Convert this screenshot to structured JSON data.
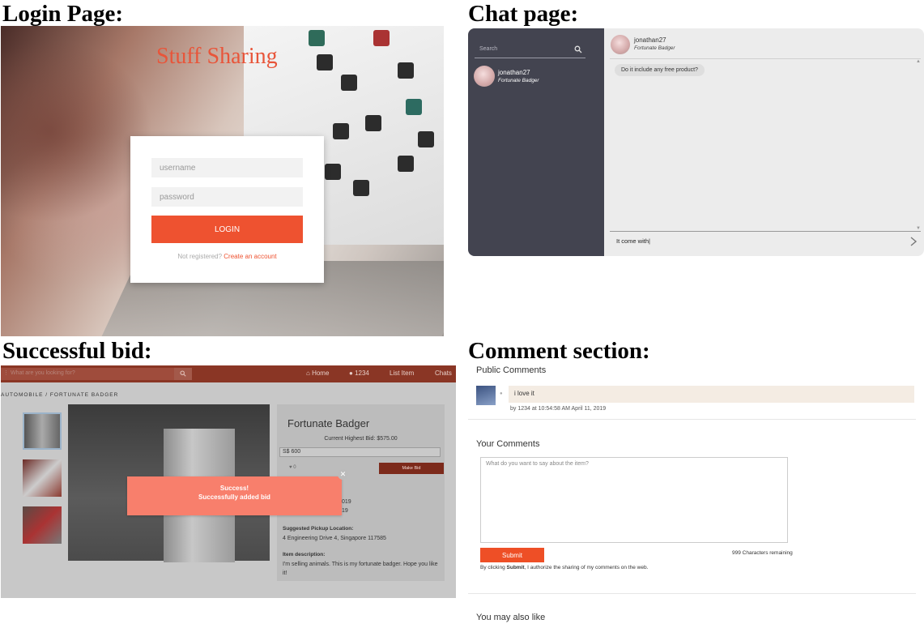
{
  "headings": {
    "login": "Login Page:",
    "chat": "Chat page:",
    "bid": "Successful bid:",
    "comments": "Comment section:"
  },
  "login": {
    "brand": "Stuff Sharing",
    "username_placeholder": "username",
    "password_placeholder": "password",
    "login_button": "LOGIN",
    "not_registered": "Not registered?",
    "create_account": "Create an account",
    "accent_color": "#ee5230"
  },
  "chat": {
    "search_placeholder": "Search",
    "contacts": [
      {
        "name": "jonathan27",
        "subtitle": "Fortunate Badger"
      }
    ],
    "header": {
      "name": "jonathan27",
      "subtitle": "Fortunate Badger"
    },
    "messages": [
      {
        "text": "Do it include any free product?"
      }
    ],
    "composer_text": "It come with"
  },
  "bid": {
    "nav": {
      "search_placeholder": "What are you looking for?",
      "home": "Home",
      "user": "1234",
      "list_item": "List Item",
      "chats": "Chats"
    },
    "breadcrumb": "AUTOMOBILE  /  FORTUNATE BADGER",
    "item_title": "Fortunate Badger",
    "current_bid": "Current Highest Bid: $575.00",
    "bid_input": "S$ 600",
    "like_count": "♥ 0",
    "make_bid": "Make Bid",
    "date_fragment_1": "019",
    "date_fragment_2": "19",
    "pickup_label": "Suggested Pickup Location:",
    "pickup_value": "4 Engineering Drive 4, Singapore 117585",
    "description_label": "Item description:",
    "description_value": "I'm selling animals. This is my fortunate badger. Hope you like it!",
    "toast": {
      "title": "Success!",
      "message": "Successfully added bid"
    }
  },
  "comments": {
    "public_title": "Public Comments",
    "items": [
      {
        "text": "i love it",
        "meta": "by 1234 at  10:54:58 AM April 11, 2019"
      }
    ],
    "your_title": "Your Comments",
    "textarea_placeholder": "What do you want to say about the item?",
    "submit": "Submit",
    "remaining": "999 Characters remaining",
    "consent_prefix": "By clicking ",
    "consent_bold": "Submit",
    "consent_suffix": ", I authorize the sharing of my comments on the web.",
    "also_like": "You may also like"
  }
}
